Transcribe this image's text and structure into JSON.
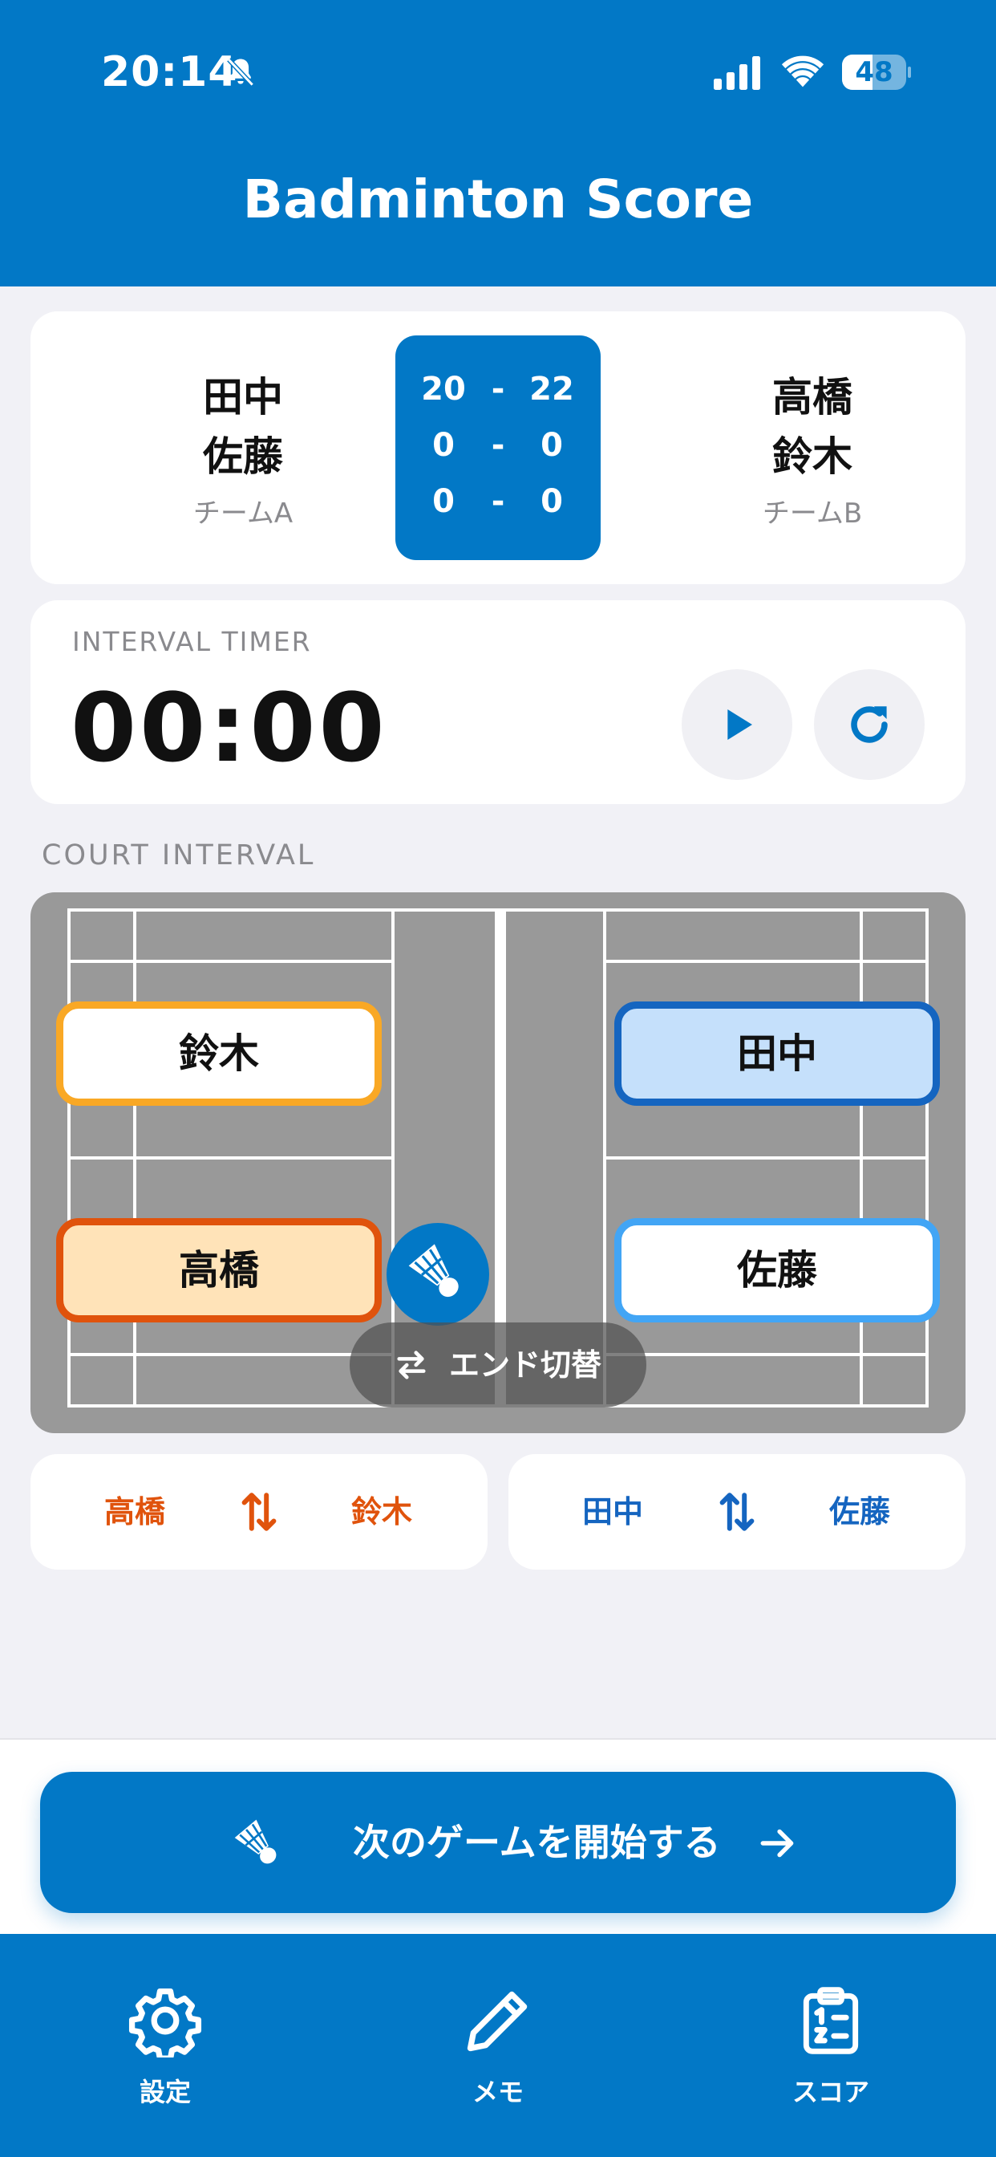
{
  "status_bar": {
    "time": "20:14",
    "battery": "48",
    "battery_level": 0.48
  },
  "app": {
    "title": "Badminton Score"
  },
  "score": {
    "team_a": {
      "players": [
        "田中",
        "佐藤"
      ],
      "label": "チームA"
    },
    "team_b": {
      "players": [
        "高橋",
        "鈴木"
      ],
      "label": "チームB"
    },
    "games": [
      {
        "a": "20",
        "sep": "-",
        "b": "22"
      },
      {
        "a": "0",
        "sep": "-",
        "b": "0"
      },
      {
        "a": "0",
        "sep": "-",
        "b": "0"
      }
    ]
  },
  "timer": {
    "label": "INTERVAL TIMER",
    "value": "00:00"
  },
  "court": {
    "section_label": "COURT INTERVAL",
    "players": {
      "left_top": "鈴木",
      "left_bottom": "高橋",
      "right_top": "田中",
      "right_bottom": "佐藤"
    },
    "end_switch_label": "エンド切替"
  },
  "swap": {
    "left": {
      "a": "高橋",
      "b": "鈴木"
    },
    "right": {
      "a": "田中",
      "b": "佐藤"
    }
  },
  "start_button": {
    "label": "次のゲームを開始する"
  },
  "tabs": [
    {
      "label": "設定",
      "icon": "gear-icon"
    },
    {
      "label": "メモ",
      "icon": "pencil-icon"
    },
    {
      "label": "スコア",
      "icon": "clipboard-list-icon"
    }
  ],
  "colors": {
    "primary": "#0278c6",
    "team_a_accent": "#e0530c",
    "team_b_accent": "#1565c0",
    "court": "#999999"
  }
}
